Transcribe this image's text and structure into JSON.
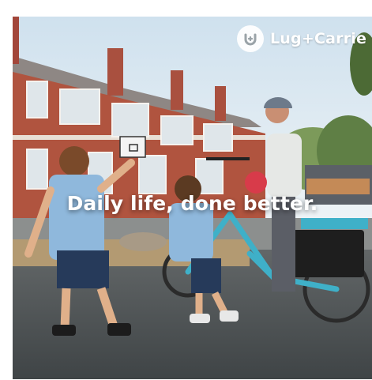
{
  "brand": {
    "name": "Lug+Carrie",
    "logo_icon": "lug-carrie-logo-icon"
  },
  "hero": {
    "headline": "Daily life, done better.",
    "image_alt": "Two children running in a school yard while an adult stands beside a blue cargo e-bike"
  },
  "colors": {
    "sky": "#dfeaf3",
    "brick": "#b0543f",
    "bike": "#3fb0c8",
    "asphalt": "#4e5356",
    "text": "#ffffff"
  }
}
